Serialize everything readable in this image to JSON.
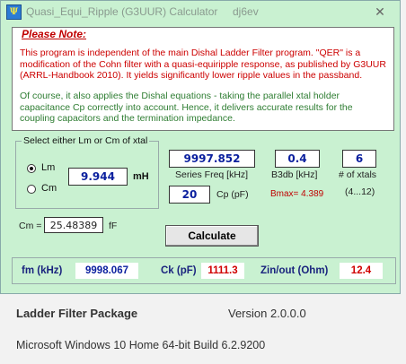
{
  "window": {
    "title": "Quasi_Equi_Ripple (G3UUR) Calculator",
    "user": "dj6ev",
    "close_glyph": "✕",
    "icon_text": "Ψ"
  },
  "note": {
    "heading": "Please Note:",
    "para1": "This program is independent of the main Dishal Ladder Filter  program. \"QER\"  is a modification of the Cohn filter with a quasi-equiripple response, as published by G3UUR (ARRL-Handbook 2010). It yields significantly lower ripple values in the passband.",
    "para2": "Of course, it also applies the Dishal equations - taking the parallel xtal holder capacitance Cp correctly into account. Hence, it delivers accurate results for the coupling capacitors and the termination impedance."
  },
  "selector": {
    "group_label": "Select either Lm or Cm of xtal",
    "lm_label": "Lm",
    "cm_label": "Cm",
    "lm_value": "9.944",
    "lm_unit": "mH",
    "selected": "Lm"
  },
  "inputs": {
    "series_freq": "9997.852",
    "series_freq_label": "Series Freq [kHz]",
    "cp": "20",
    "cp_label": "Cp (pF)",
    "b3db": "0.4",
    "b3db_label": "B3db [kHz]",
    "bmax": "Bmax= 4.389",
    "xtals": "6",
    "xtals_label": "# of xtals",
    "xtals_range": "(4...12)"
  },
  "cm": {
    "label": "Cm =",
    "value": "25.48389",
    "unit": "fF"
  },
  "calculate_label": "Calculate",
  "results": {
    "fm_label": "fm (kHz)",
    "fm_value": "9998.067",
    "ck_label": "Ck (pF)",
    "ck_value": "1111.3",
    "zin_label": "Zin/out (Ohm)",
    "zin_value": "12.4"
  },
  "footer": {
    "package_name": "Ladder Filter Package",
    "version": "Version 2.0.0.0",
    "os": "Microsoft Windows 10 Home 64-bit Build 6.2.9200"
  },
  "colors": {
    "window_bg": "#c9f1d1",
    "note_red": "#cc0000",
    "note_green": "#2e7d32",
    "value_blue": "#0a1f9e",
    "result_red": "#d00000"
  }
}
